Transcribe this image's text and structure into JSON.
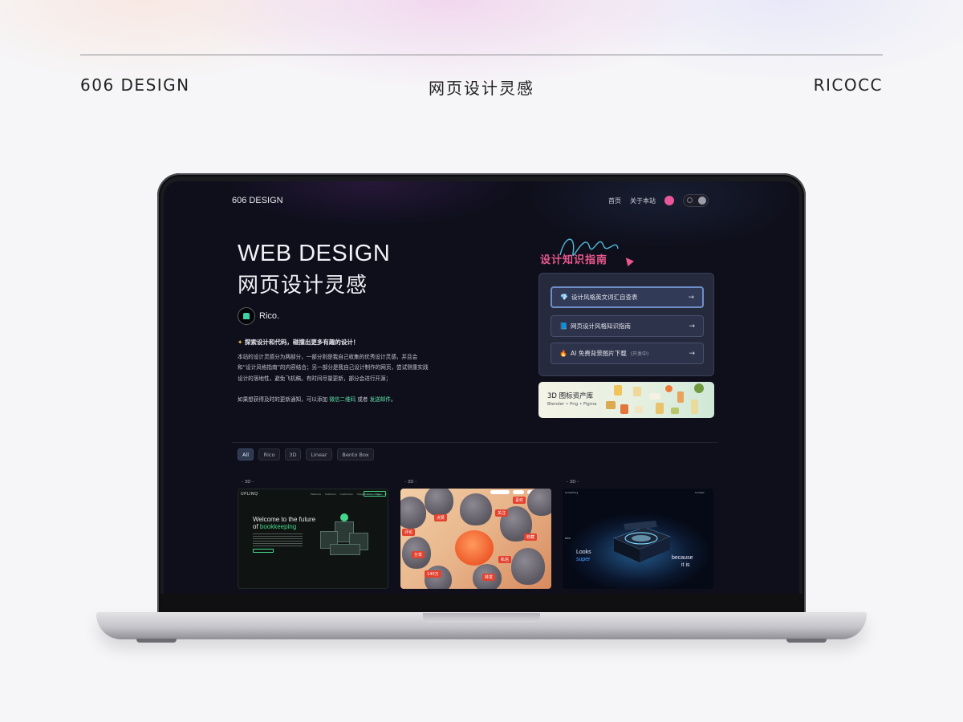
{
  "page_header": {
    "left": "606 DESIGN",
    "center": "网页设计灵感",
    "right": "RICOCC"
  },
  "site": {
    "nav": {
      "logo": "606 DESIGN",
      "home": "首页",
      "about": "关于本站"
    },
    "hero": {
      "title_en": "WEB DESIGN",
      "title_cn": "网页设计灵感",
      "author": "Rico.",
      "tagline": "探索设计和代码，碰撞出更多有趣的设计！",
      "desc": "本站的设计灵感分为两部分，一部分则是我自己收集的优秀设计灵感，并且会和“设计风格指南”的内容结合；另一部分是我自己设计制作的网页，尝试侧重实践设计的落地性，避免飞机稿。有时间尽量更新，部分会进行开源；",
      "notify_prefix": "如果想获得及时的更新通知，可以添加",
      "notify_wechat": "微信二维码",
      "notify_or": "或者",
      "notify_mail": "发送邮件",
      "notify_end": "。"
    },
    "guide": {
      "title": "设计知识指南",
      "items": [
        {
          "icon": "diamond-icon",
          "glyph": "💎",
          "label": "设计风格英文词汇自查表",
          "sub": ""
        },
        {
          "icon": "book-icon",
          "glyph": "📘",
          "label": "网页设计风格知识指南",
          "sub": ""
        },
        {
          "icon": "fire-icon",
          "glyph": "🔥",
          "label": "AI 免费背景图片下载",
          "sub": "(开发中)"
        }
      ],
      "arrow": "→"
    },
    "assets_card": {
      "title": "3D 图标资产库",
      "subtitle": "Blender • Png • Figma"
    },
    "filters": [
      "All",
      "Rico",
      "3D",
      "Linear",
      "Bento Box"
    ],
    "cards": [
      {
        "tag": "- 3D -",
        "logo": "UPLINQ",
        "menu": "Features Solutions Customers Integrations Sign in",
        "cta": "Contact Sales",
        "headline_1": "Welcome to the future",
        "headline_2_prefix": "of ",
        "headline_2_highlight": "bookkeeping"
      },
      {
        "tag": "- 3D -",
        "badges": [
          "关注",
          "点赞",
          "收藏",
          "评论",
          "喜欢",
          "分享",
          "转发",
          "私信",
          "140万"
        ]
      },
      {
        "tag": "- 3D -",
        "top_left": "Something",
        "top_right": "Contact",
        "small": "NEW",
        "looks": "Looks",
        "super": "super",
        "because": "because",
        "it_is": "it is"
      }
    ]
  },
  "colors": {
    "screen_bg": "#0f0f1c",
    "accent_pink": "#e9578e",
    "accent_green": "#5ee0a8",
    "panel_bg": "#252a3c"
  }
}
